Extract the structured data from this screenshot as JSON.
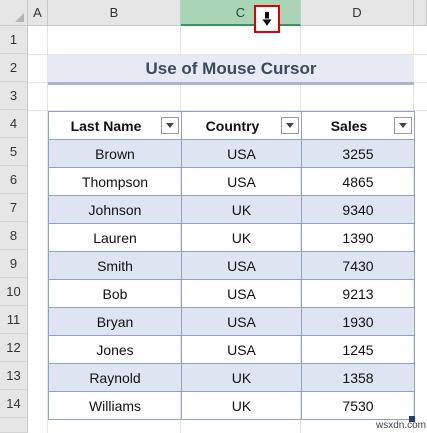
{
  "columns": [
    "A",
    "B",
    "C",
    "D"
  ],
  "rows": [
    "1",
    "2",
    "3",
    "4",
    "5",
    "6",
    "7",
    "8",
    "9",
    "10",
    "11",
    "12",
    "13",
    "14"
  ],
  "title": "Use of Mouse Cursor",
  "table": {
    "headers": [
      "Last Name",
      "Country",
      "Sales"
    ],
    "rows": [
      [
        "Brown",
        "USA",
        "3255"
      ],
      [
        "Thompson",
        "USA",
        "4865"
      ],
      [
        "Johnson",
        "UK",
        "9340"
      ],
      [
        "Lauren",
        "UK",
        "1390"
      ],
      [
        "Smith",
        "USA",
        "7430"
      ],
      [
        "Bob",
        "USA",
        "9213"
      ],
      [
        "Bryan",
        "USA",
        "1930"
      ],
      [
        "Jones",
        "USA",
        "1245"
      ],
      [
        "Raynold",
        "UK",
        "1358"
      ],
      [
        "Williams",
        "UK",
        "7530"
      ]
    ]
  },
  "selected_column": "C",
  "cursor_icon": "down-arrow-select-column-icon",
  "watermark": "wsxdn.com",
  "colors": {
    "selected_header": "#a9d4b6",
    "band": "#dfe4f3",
    "table_border": "#8fa3c6",
    "title_fill": "#e7eaf2",
    "cursor_highlight": "#e00000"
  }
}
